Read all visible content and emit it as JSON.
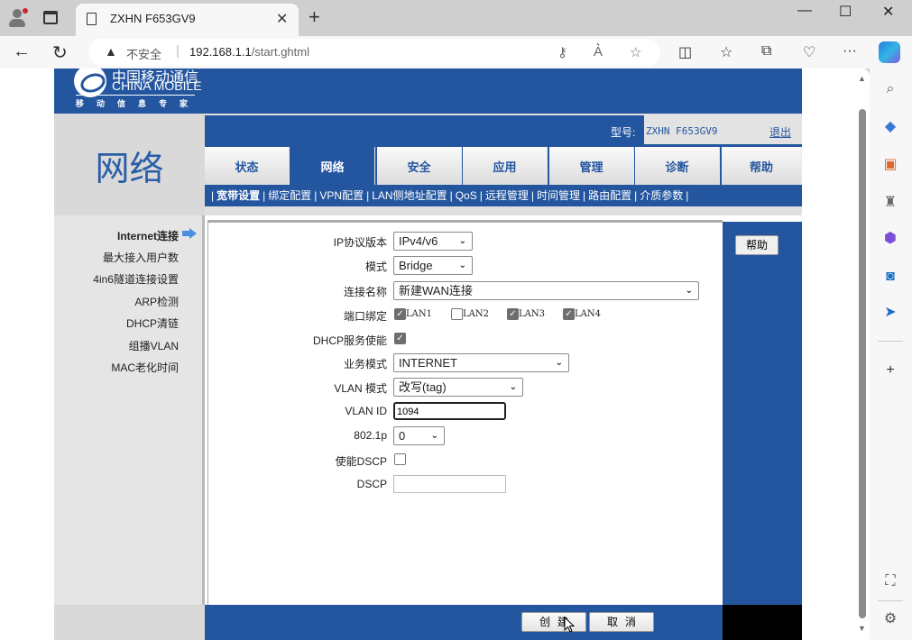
{
  "browser": {
    "tab_title": "ZXHN F653GV9",
    "security_label": "不安全",
    "url_host": "192.168.1.1",
    "url_path": "/start.ghtml",
    "toolbar_icons": [
      "password-key-icon",
      "read-aloud-icon",
      "favorite-star-icon",
      "split-screen-icon",
      "favorites-icon",
      "collections-icon",
      "browser-essentials-icon",
      "more-icon",
      "copilot-icon"
    ],
    "sidebar_icons": [
      "search-icon",
      "shopping-tag-icon",
      "tools-icon",
      "games-icon",
      "microsoft365-icon",
      "outlook-icon",
      "send-icon",
      "add-icon",
      "screenshot-icon",
      "settings-icon"
    ]
  },
  "router": {
    "brand_cn": "中国移动通信",
    "brand_en": "CHINA MOBILE",
    "slogan": "移动信息专家",
    "section_title": "网络",
    "model_label": "型号:",
    "model_value": "ZXHN F653GV9",
    "logout": "退出",
    "menu": [
      {
        "label": "状态",
        "active": false
      },
      {
        "label": "网络",
        "active": true
      },
      {
        "label": "安全",
        "active": false
      },
      {
        "label": "应用",
        "active": false
      },
      {
        "label": "管理",
        "active": false
      },
      {
        "label": "诊断",
        "active": false
      },
      {
        "label": "帮助",
        "active": false
      }
    ],
    "submenu": [
      "宽带设置",
      "绑定配置",
      "VPN配置",
      "LAN侧地址配置",
      "QoS",
      "远程管理",
      "时间管理",
      "路由配置",
      "介质参数"
    ],
    "left_nav": [
      "Internet连接",
      "最大接入用户数",
      "4in6隧道连接设置",
      "ARP检测",
      "DHCP清链",
      "组播VLAN",
      "MAC老化时间"
    ],
    "help_button": "帮助",
    "form": {
      "ip_version": {
        "label": "IP协议版本",
        "value": "IPv4/v6"
      },
      "mode": {
        "label": "模式",
        "value": "Bridge"
      },
      "conn_name": {
        "label": "连接名称",
        "value": "新建WAN连接"
      },
      "port_bind": {
        "label": "端口绑定",
        "ports": [
          {
            "label": "LAN1",
            "checked": true
          },
          {
            "label": "LAN2",
            "checked": false
          },
          {
            "label": "LAN3",
            "checked": true
          },
          {
            "label": "LAN4",
            "checked": true
          }
        ]
      },
      "dhcp_service": {
        "label": "DHCP服务使能",
        "checked": true
      },
      "service_mode": {
        "label": "业务模式",
        "value": "INTERNET"
      },
      "vlan_mode": {
        "label": "VLAN 模式",
        "value": "改写(tag)"
      },
      "vlan_id": {
        "label": "VLAN ID",
        "value": "1094"
      },
      "dot1p": {
        "label": "802.1p",
        "value": "0"
      },
      "enable_dscp": {
        "label": "使能DSCP",
        "checked": false
      },
      "dscp": {
        "label": "DSCP",
        "value": ""
      }
    },
    "create_button": "创建",
    "cancel_button": "取消"
  }
}
